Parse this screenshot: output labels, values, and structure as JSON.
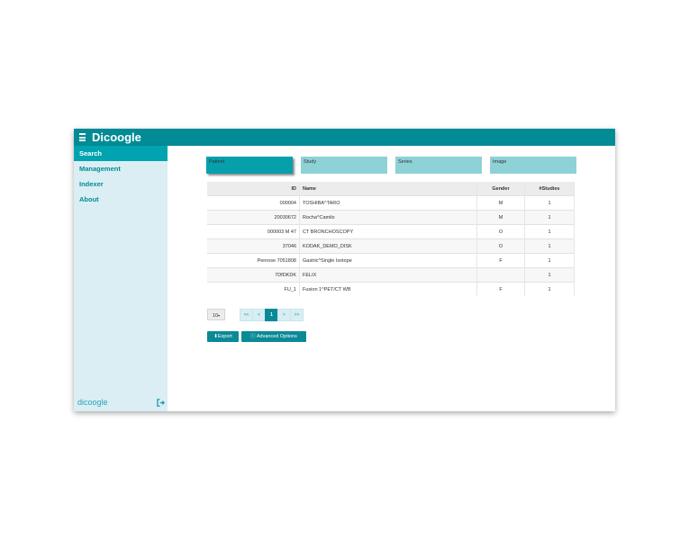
{
  "app": {
    "title": "Dicoogle",
    "footer_logo": "dicoogle"
  },
  "sidebar": {
    "items": [
      {
        "label": "Search",
        "active": true
      },
      {
        "label": "Management",
        "active": false
      },
      {
        "label": "Indexer",
        "active": false
      },
      {
        "label": "About",
        "active": false
      }
    ]
  },
  "tabs": [
    {
      "label": "Patient",
      "active": true
    },
    {
      "label": "Study",
      "active": false
    },
    {
      "label": "Series",
      "active": false
    },
    {
      "label": "Image",
      "active": false
    }
  ],
  "table": {
    "headers": {
      "id": "ID",
      "name": "Name",
      "gender": "Gender",
      "studies": "#Studies"
    },
    "rows": [
      {
        "id": "000004",
        "name": "TOSHIBA^TARO",
        "gender": "M",
        "studies": "1"
      },
      {
        "id": "20030672",
        "name": "Rocha^Camilo",
        "gender": "M",
        "studies": "1"
      },
      {
        "id": "000003 M 47",
        "name": "CT BRONCHOSCOPY",
        "gender": "O",
        "studies": "1"
      },
      {
        "id": "37046",
        "name": "KODAK_DEMO_DISK",
        "gender": "O",
        "studies": "1"
      },
      {
        "id": "Penrose 7051808",
        "name": "Gastric^Single Isotope",
        "gender": "F",
        "studies": "1"
      },
      {
        "id": "7DfDKDK",
        "name": "FELIX",
        "gender": "",
        "studies": "1"
      },
      {
        "id": "FU_1",
        "name": "Fusion 1^PET/CT WB",
        "gender": "F",
        "studies": "1"
      }
    ]
  },
  "pagination": {
    "page_size": "10",
    "first": "<<",
    "prev": "<",
    "current": "1",
    "next": ">",
    "last": ">>"
  },
  "actions": {
    "export_label": "Export",
    "advanced_label": "Advanced Options"
  },
  "colors": {
    "accent": "#008b95",
    "sidebar_bg": "#daeef4",
    "tab_bg": "#8ed1d6"
  }
}
